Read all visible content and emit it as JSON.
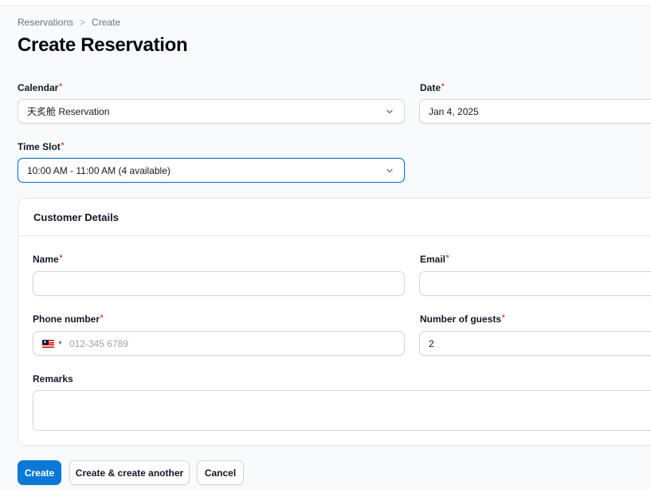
{
  "breadcrumb": {
    "parent": "Reservations",
    "separator": ">",
    "current": "Create"
  },
  "page": {
    "title": "Create Reservation"
  },
  "form": {
    "calendar": {
      "label": "Calendar",
      "value": "天炙舱 Reservation"
    },
    "date": {
      "label": "Date",
      "value": "Jan 4, 2025"
    },
    "time_slot": {
      "label": "Time Slot",
      "value": "10:00 AM - 11:00 AM (4 available)"
    },
    "required_marker": "*"
  },
  "customer": {
    "title": "Customer Details",
    "name": {
      "label": "Name",
      "value": ""
    },
    "email": {
      "label": "Email",
      "value": ""
    },
    "phone": {
      "label": "Phone number",
      "placeholder": "012-345 6789",
      "country_flag": "MY"
    },
    "guests": {
      "label": "Number of guests",
      "value": "2"
    },
    "remarks": {
      "label": "Remarks",
      "value": ""
    }
  },
  "actions": {
    "create": "Create",
    "create_another": "Create & create another",
    "cancel": "Cancel"
  },
  "colors": {
    "primary": "#0b78d6",
    "required": "#dc2626"
  }
}
